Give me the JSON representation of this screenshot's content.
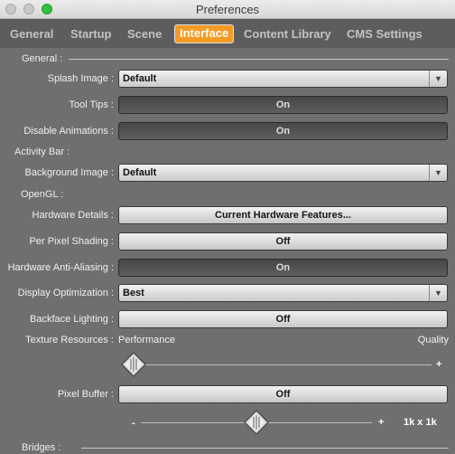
{
  "window": {
    "title": "Preferences"
  },
  "tabs": [
    "General",
    "Startup",
    "Scene",
    "Interface",
    "Content Library",
    "CMS Settings"
  ],
  "active_tab": "Interface",
  "sections": {
    "general": "General :",
    "activity_bar": "Activity Bar :",
    "opengl": "OpenGL :",
    "bridges": "Bridges :"
  },
  "rows": {
    "splash_image": {
      "label": "Splash Image :",
      "value": "Default"
    },
    "tool_tips": {
      "label": "Tool Tips :",
      "value": "On"
    },
    "disable_animations": {
      "label": "Disable Animations :",
      "value": "On"
    },
    "background_image": {
      "label": "Background Image :",
      "value": "Default"
    },
    "hardware_details": {
      "label": "Hardware Details :",
      "button": "Current Hardware Features..."
    },
    "per_pixel_shading": {
      "label": "Per Pixel Shading :",
      "value": "Off"
    },
    "hw_antialiasing": {
      "label": "Hardware Anti-Aliasing :",
      "value": "On"
    },
    "display_optimization": {
      "label": "Display Optimization :",
      "value": "Best"
    },
    "backface_lighting": {
      "label": "Backface Lighting :",
      "value": "Off"
    },
    "pixel_buffer": {
      "label": "Pixel Buffer :",
      "value": "Off"
    }
  },
  "texture_resources": {
    "label": "Texture Resources :",
    "min_label": "Performance",
    "max_label": "Quality",
    "plus": "+",
    "level": 0.0
  },
  "pixel_buffer_slider": {
    "minus": "-",
    "plus": "+",
    "value_text": "1k x 1k",
    "level": 0.5
  },
  "colors": {
    "accent": "#f59a22",
    "panel": "#6f6f6f",
    "tabbar": "#5d5d5d"
  }
}
